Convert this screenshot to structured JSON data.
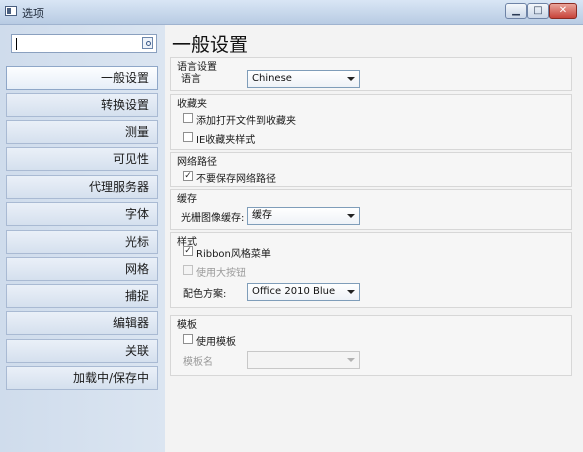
{
  "window": {
    "title": "选项"
  },
  "search": {
    "value": ""
  },
  "sidebar": {
    "items": [
      {
        "label": "一般设置"
      },
      {
        "label": "转换设置"
      },
      {
        "label": "测量"
      },
      {
        "label": "可见性"
      },
      {
        "label": "代理服务器"
      },
      {
        "label": "字体"
      },
      {
        "label": "光标"
      },
      {
        "label": "网格"
      },
      {
        "label": "捕捉"
      },
      {
        "label": "编辑器"
      },
      {
        "label": "关联"
      },
      {
        "label": "加载中/保存中"
      }
    ]
  },
  "main": {
    "page_title": "一般设置",
    "language_group": {
      "title": "语言设置",
      "label": "语言",
      "value": "Chinese"
    },
    "favorites_group": {
      "title": "收藏夹",
      "add_open_files": {
        "label": "添加打开文件到收藏夹",
        "checked": false
      },
      "ie_favorites_style": {
        "label": "IE收藏夹样式",
        "checked": false
      }
    },
    "network_group": {
      "title": "网络路径",
      "do_not_save": {
        "label": "不要保存网络路径",
        "checked": true,
        "mark": "✓"
      }
    },
    "cache_group": {
      "title": "缓存",
      "label": "光栅图像缓存:",
      "value": "缓存"
    },
    "style_group": {
      "title": "样式",
      "ribbon_menu": {
        "label": "Ribbon风格菜单",
        "checked": true,
        "mark": "✓"
      },
      "large_buttons": {
        "label": "使用大按钮",
        "checked": false,
        "disabled": true
      },
      "color_scheme_label": "配色方案:",
      "color_scheme_value": "Office 2010 Blue"
    },
    "template_group": {
      "title": "模板",
      "use_template": {
        "label": "使用模板",
        "checked": false
      },
      "template_name_label": "模板名",
      "template_name_value": ""
    }
  }
}
